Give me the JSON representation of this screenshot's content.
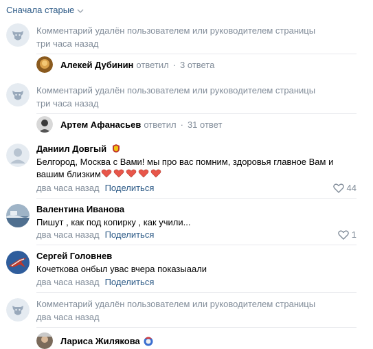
{
  "sort_label": "Сначала старые",
  "deleted_text": "Комментарий удалён пользователем или руководителем страницы",
  "share_label": "Поделиться",
  "replied_label": "ответил",
  "items": [
    {
      "type": "deleted",
      "time": "три часа назад",
      "reply": {
        "name": "Алекей Дубинин",
        "count": "3 ответа"
      }
    },
    {
      "type": "deleted",
      "time": "три часа назад",
      "reply": {
        "name": "Артем Афанасьев",
        "count": "31 ответ"
      }
    },
    {
      "type": "comment",
      "name": "Даниил Довгый",
      "text": "Белгород, Москва с Вами! мы про вас помним, здоровья главное Вам и вашим близким",
      "time": "два часа назад",
      "likes": "44"
    },
    {
      "type": "comment",
      "name": "Валентина Иванова",
      "text": "Пишут , как под копирку , как учили...",
      "time": "два часа назад",
      "likes": "1"
    },
    {
      "type": "comment",
      "name": "Сергей Головнев",
      "text": "Кочеткова онбыл увас вчера показыаали",
      "time": "два часа назад"
    },
    {
      "type": "deleted",
      "time": "два часа назад",
      "reply": {
        "name": "Лариса Жилякова"
      }
    }
  ]
}
